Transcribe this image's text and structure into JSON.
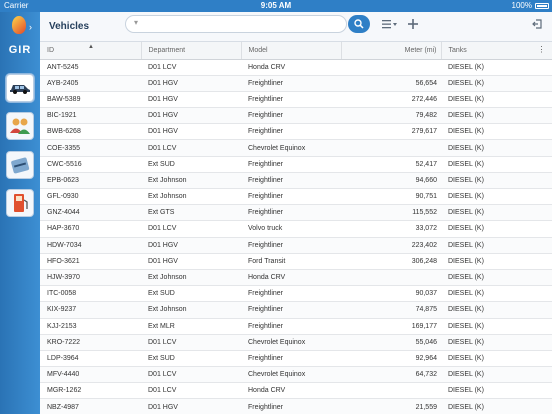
{
  "status": {
    "carrier": "Carrier",
    "time": "9:05 AM",
    "battery": "100%"
  },
  "header": {
    "title": "Vehicles",
    "search_placeholder": ""
  },
  "table": {
    "columns": [
      "ID",
      "Department",
      "Model",
      "Meter (mi)",
      "Tanks"
    ],
    "rows": [
      [
        "ANT-5245",
        "D01 LCV",
        "Honda CRV",
        "",
        "DIESEL (K)"
      ],
      [
        "AYB-2405",
        "D01 HGV",
        "Freightliner",
        "56,654",
        "DIESEL (K)"
      ],
      [
        "BAW-5389",
        "D01 HGV",
        "Freightliner",
        "272,446",
        "DIESEL (K)"
      ],
      [
        "BIC-1921",
        "D01 HGV",
        "Freightliner",
        "79,482",
        "DIESEL (K)"
      ],
      [
        "BWB-6268",
        "D01 HGV",
        "Freightliner",
        "279,617",
        "DIESEL (K)"
      ],
      [
        "COE-3355",
        "D01 LCV",
        "Chevrolet Equinox",
        "",
        "DIESEL (K)"
      ],
      [
        "CWC-5516",
        "Ext SUD",
        "Freightliner",
        "52,417",
        "DIESEL (K)"
      ],
      [
        "EPB-0623",
        "Ext Johnson",
        "Freightliner",
        "94,660",
        "DIESEL (K)"
      ],
      [
        "GFL-0930",
        "Ext Johnson",
        "Freightliner",
        "90,751",
        "DIESEL (K)"
      ],
      [
        "GNZ-4044",
        "Ext GTS",
        "Freightliner",
        "115,552",
        "DIESEL (K)"
      ],
      [
        "HAP-3670",
        "D01 LCV",
        "Volvo truck",
        "33,072",
        "DIESEL (K)"
      ],
      [
        "HDW-7034",
        "D01 HGV",
        "Freightliner",
        "223,402",
        "DIESEL (K)"
      ],
      [
        "HFO-3621",
        "D01 HGV",
        "Ford Transit",
        "306,248",
        "DIESEL (K)"
      ],
      [
        "HJW-3970",
        "Ext Johnson",
        "Honda CRV",
        "",
        "DIESEL (K)"
      ],
      [
        "ITC-0058",
        "Ext SUD",
        "Freightliner",
        "90,037",
        "DIESEL (K)"
      ],
      [
        "KIX-9237",
        "Ext Johnson",
        "Freightliner",
        "74,875",
        "DIESEL (K)"
      ],
      [
        "KJJ-2153",
        "Ext MLR",
        "Freightliner",
        "169,177",
        "DIESEL (K)"
      ],
      [
        "KRO-7222",
        "D01 LCV",
        "Chevrolet Equinox",
        "55,046",
        "DIESEL (K)"
      ],
      [
        "LDP-3964",
        "Ext SUD",
        "Freightliner",
        "92,964",
        "DIESEL (K)"
      ],
      [
        "MFV-4440",
        "D01 LCV",
        "Chevrolet Equinox",
        "64,732",
        "DIESEL (K)"
      ],
      [
        "MGR-1262",
        "D01 LCV",
        "Honda CRV",
        "",
        "DIESEL (K)"
      ],
      [
        "NBZ-4987",
        "D01 HGV",
        "Freightliner",
        "21,559",
        "DIESEL (K)"
      ]
    ]
  },
  "sidebar": {
    "logo_text": "GIR",
    "items": [
      "vehicles-icon",
      "people-icon",
      "fuel-card-icon",
      "fuel-pump-icon"
    ]
  },
  "colors": {
    "accent": "#2f7fc6",
    "sidebar": "#3d8fd3"
  }
}
